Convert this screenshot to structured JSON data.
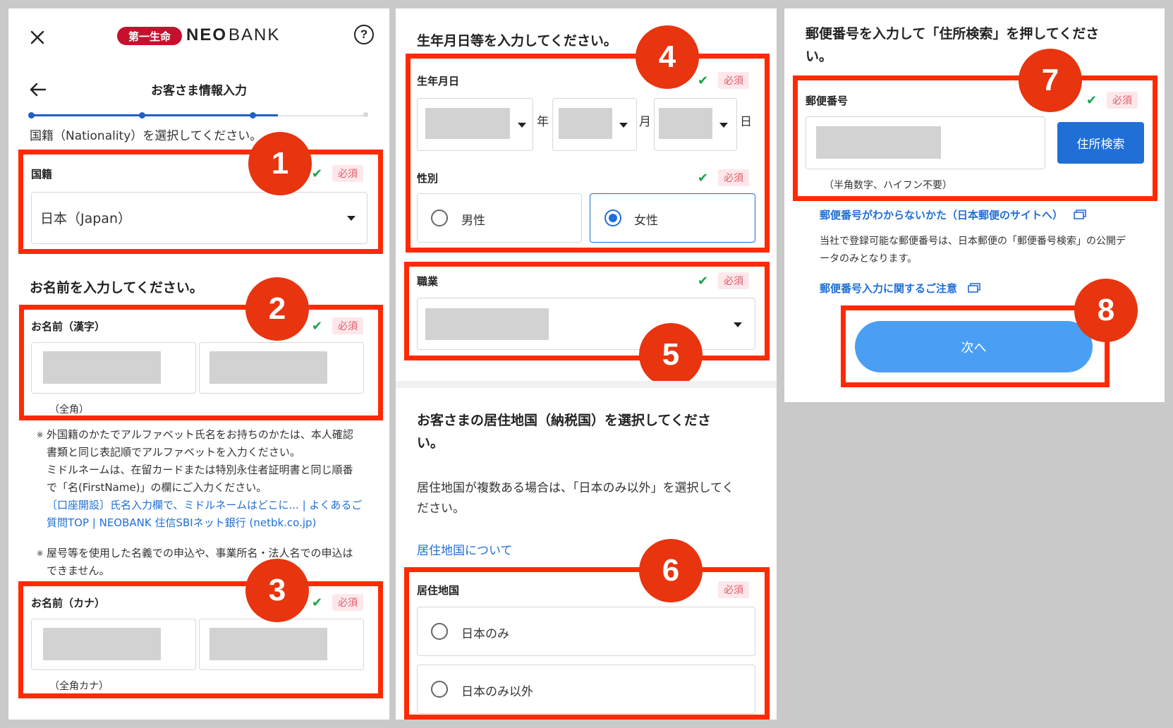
{
  "header": {
    "logo_badge": "第一生命",
    "logo_neo": "NEO",
    "logo_bank": "BANK",
    "page_title": "お客さま情報入力"
  },
  "common": {
    "required": "必須"
  },
  "panel1": {
    "nationality_prompt": "国籍（Nationality）を選択してください。",
    "nationality_label": "国籍",
    "nationality_value": "日本（Japan）",
    "name_heading": "お名前を入力してください。",
    "name_kanji_label": "お名前（漢字）",
    "name_kanji_hint": "（全角）",
    "note1_lines": [
      "外国籍のかたでアルファベット氏名をお持ちのかたは、本人確認",
      "書類と同じ表記順でアルファベットを入力ください。",
      "ミドルネームは、在留カードまたは特別永住者証明書と同じ順番",
      "で「名(FirstName)」の欄にご入力ください。"
    ],
    "note1_link_lines": [
      "〔口座開設〕氏名入力欄で、ミドルネームはどこに... | よくあるご",
      "質問TOP | NEOBANK 住信SBIネット銀行 (netbk.co.jp)"
    ],
    "note2_lines": [
      "屋号等を使用した名義での申込や、事業所名・法人名での申込は",
      "できません。"
    ],
    "note_mark": "※",
    "name_kana_label": "お名前（カナ）",
    "name_kana_hint": "（全角カナ）"
  },
  "panel2": {
    "birth_heading": "生年月日等を入力してください。",
    "birth_label": "生年月日",
    "year_unit": "年",
    "month_unit": "月",
    "day_unit": "日",
    "gender_label": "性別",
    "gender_options": [
      "男性",
      "女性"
    ],
    "gender_selected": "女性",
    "occupation_label": "職業",
    "residence_heading_lines": [
      "お客さまの居住地国（納税国）を選択してくださ",
      "い。"
    ],
    "residence_body_lines": [
      "居住地国が複数ある場合は、「日本のみ以外」を選択してく",
      "ださい。"
    ],
    "residence_link": "居住地国について",
    "residence_label": "居住地国",
    "residence_options": [
      "日本のみ",
      "日本のみ以外"
    ]
  },
  "panel3": {
    "postal_heading_lines": [
      "郵便番号を入力して「住所検索」を押してくださ",
      "い。"
    ],
    "postal_label": "郵便番号",
    "search_button": "住所検索",
    "postal_hint": "（半角数字、ハイフン不要）",
    "postal_help_link": "郵便番号がわからないかた（日本郵便のサイトへ）",
    "postal_body_lines": [
      "当社で登録可能な郵便番号は、日本郵便の「郵便番号検索」の公開デ",
      "ータのみとなります。"
    ],
    "postal_note_link": "郵便番号入力に関するご注意",
    "next_button": "次へ"
  },
  "badges": [
    "1",
    "2",
    "3",
    "4",
    "5",
    "6",
    "7",
    "8"
  ],
  "colors": {
    "highlight": "#ff2a00",
    "badge": "#e8340f",
    "primary": "#1f6fd6",
    "next_button": "#4a9ff5",
    "required_text": "#e05a66",
    "check": "#1aa34a"
  }
}
